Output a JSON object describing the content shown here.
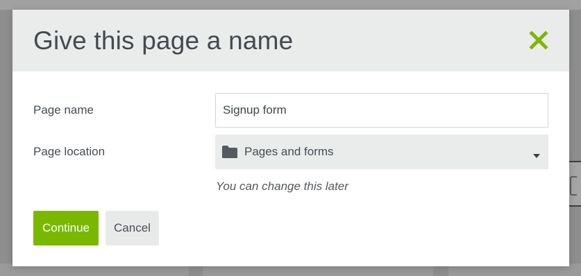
{
  "dialog": {
    "title": "Give this page a name",
    "close_icon": "close-x-icon",
    "accent_color": "#7ab800"
  },
  "form": {
    "page_name_label": "Page name",
    "page_name_value": "Signup form",
    "page_location_label": "Page location",
    "page_location_icon": "folder-icon",
    "page_location_value": "Pages and forms",
    "page_location_hint": "You can change this later"
  },
  "actions": {
    "continue_label": "Continue",
    "cancel_label": "Cancel"
  }
}
